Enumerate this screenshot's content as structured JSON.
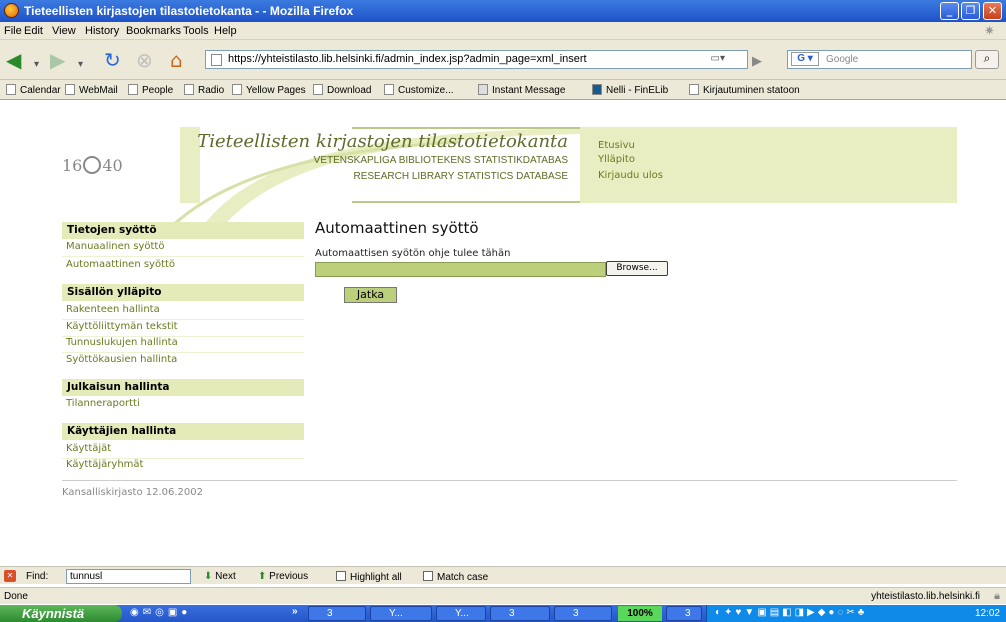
{
  "window": {
    "title": "Tieteellisten kirjastojen tilastotietokanta - - Mozilla Firefox"
  },
  "menu": [
    "File",
    "Edit",
    "View",
    "History",
    "Bookmarks",
    "Tools",
    "Help"
  ],
  "address": {
    "url": "https://yhteistilasto.lib.helsinki.fi/admin_index.jsp?admin_page=xml_insert",
    "search_placeholder": "Google"
  },
  "bookmarks": [
    "Calendar",
    "WebMail",
    "People",
    "Radio",
    "Yellow Pages",
    "Download",
    "Customize...",
    "Instant Message",
    "Nelli - FinELib",
    "Kirjautuminen statoon"
  ],
  "site": {
    "title": "Tieteellisten kirjastojen tilastotietokanta",
    "subtitle_sv": "VETENSKAPLIGA BIBLIOTEKENS STATISTIKDATABAS",
    "subtitle_en": "RESEARCH LIBRARY STATISTICS DATABASE",
    "logo_text_left": "16",
    "logo_text_right": "40",
    "top_links": [
      "Etusivu",
      "Ylläpito",
      "Kirjaudu ulos"
    ]
  },
  "sidebar": {
    "sections": [
      {
        "title": "Tietojen syöttö",
        "items": [
          "Manuaalinen syöttö",
          "Automaattinen syöttö"
        ]
      },
      {
        "title": "Sisällön ylläpito",
        "items": [
          "Rakenteen hallinta",
          "Käyttöliittymän tekstit",
          "Tunnuslukujen hallinta",
          "Syöttökausien hallinta"
        ]
      },
      {
        "title": "Julkaisun hallinta",
        "items": [
          "Tilanneraportti"
        ]
      },
      {
        "title": "Käyttäjien hallinta",
        "items": [
          "Käyttäjät",
          "Käyttäjäryhmät"
        ]
      }
    ]
  },
  "main": {
    "heading": "Automaattinen syöttö",
    "upload_label": "Automaattisen syötön ohje tulee tähän",
    "browse_label": "Browse...",
    "submit_label": "Jatka"
  },
  "footer": "Kansalliskirjasto 12.06.2002",
  "findbar": {
    "label": "Find:",
    "value": "tunnusl",
    "next": "Next",
    "previous": "Previous",
    "highlight": "Highlight all",
    "match_case": "Match case"
  },
  "status": {
    "left": "Done",
    "right": "yhteistilasto.lib.helsinki.fi"
  },
  "taskbar": {
    "start": "Käynnistä",
    "zoom": "100%",
    "clock": "12:02",
    "buttons": [
      "3",
      "Y...",
      "Y...",
      "3",
      "3",
      "3"
    ]
  }
}
